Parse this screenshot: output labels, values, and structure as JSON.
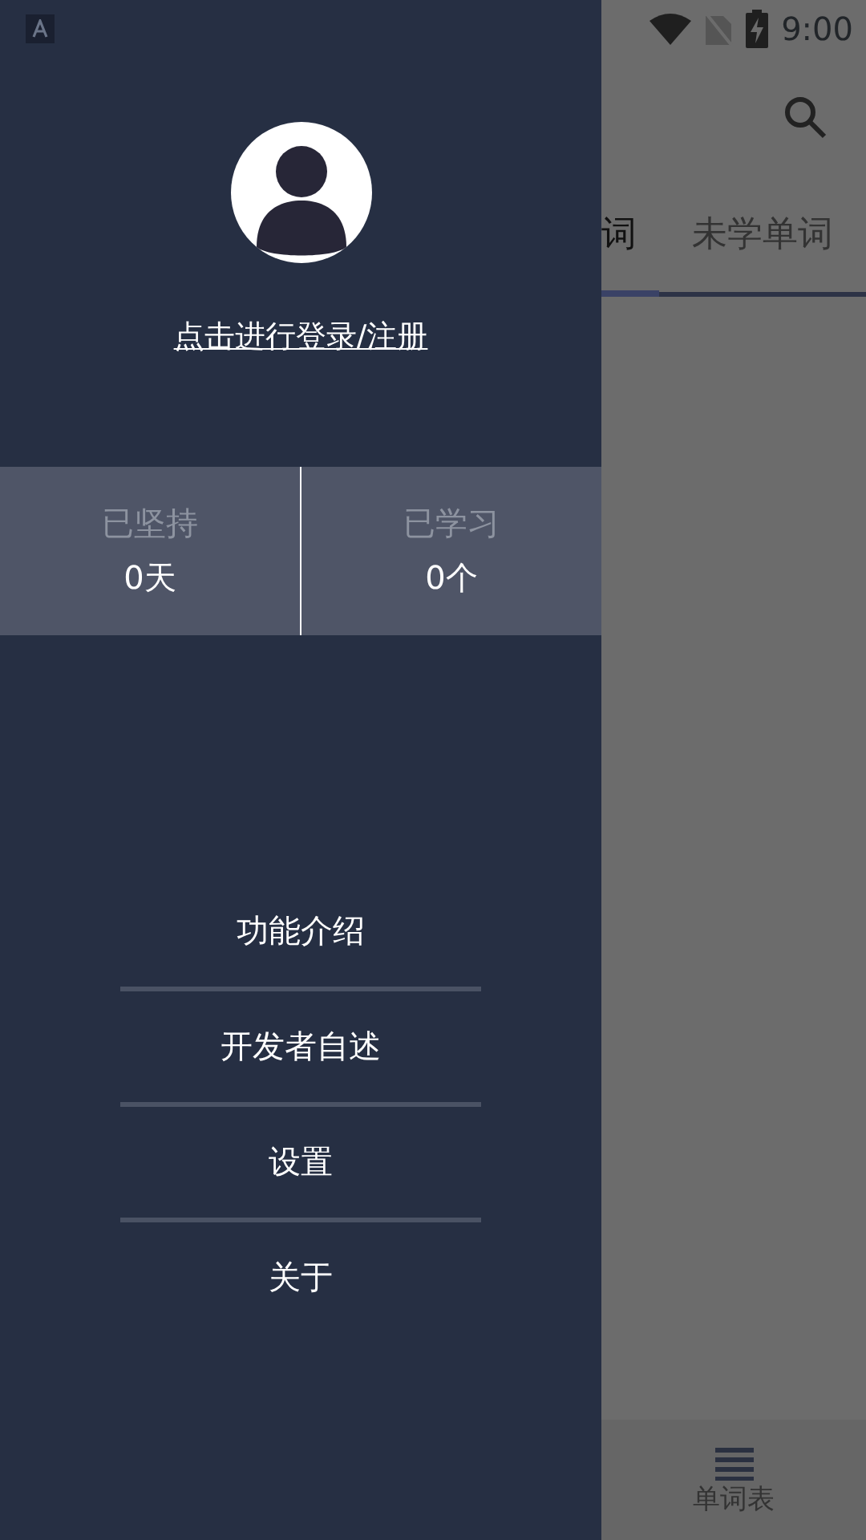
{
  "status_bar": {
    "time": "9:00"
  },
  "drawer": {
    "login_link": "点击进行登录/注册",
    "stats": [
      {
        "label": "已坚持",
        "value": "0天"
      },
      {
        "label": "已学习",
        "value": "0个"
      }
    ],
    "menu": [
      "功能介绍",
      "开发者自述",
      "设置",
      "关于"
    ]
  },
  "tabs": [
    {
      "label": "词",
      "selected": true
    },
    {
      "label": "未学单词",
      "selected": false
    }
  ],
  "bottom_nav": [
    {
      "label": "单词表"
    }
  ]
}
